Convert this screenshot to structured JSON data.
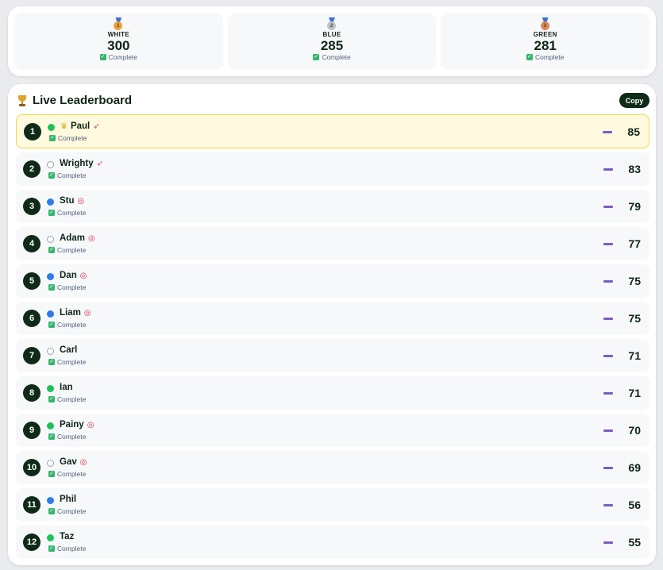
{
  "teams": [
    {
      "name": "WHITE",
      "score": "300",
      "status": "Complete",
      "medal_number": "1",
      "medal_color": "#e6a23c"
    },
    {
      "name": "BLUE",
      "score": "285",
      "status": "Complete",
      "medal_number": "2",
      "medal_color": "#b9c2cc"
    },
    {
      "name": "GREEN",
      "score": "281",
      "status": "Complete",
      "medal_number": "3",
      "medal_color": "#d98a5a"
    }
  ],
  "leaderboard": {
    "title": "Live Leaderboard",
    "copy_label": "Copy",
    "rows": [
      {
        "rank": "1",
        "name": "Paul",
        "status": "Complete",
        "score": "85",
        "team_dot": "green",
        "crown": true,
        "badge": "rocket"
      },
      {
        "rank": "2",
        "name": "Wrighty",
        "status": "Complete",
        "score": "83",
        "team_dot": "none",
        "crown": false,
        "badge": "rocket"
      },
      {
        "rank": "3",
        "name": "Stu",
        "status": "Complete",
        "score": "79",
        "team_dot": "blue",
        "crown": false,
        "badge": "target"
      },
      {
        "rank": "4",
        "name": "Adam",
        "status": "Complete",
        "score": "77",
        "team_dot": "none",
        "crown": false,
        "badge": "target"
      },
      {
        "rank": "5",
        "name": "Dan",
        "status": "Complete",
        "score": "75",
        "team_dot": "blue",
        "crown": false,
        "badge": "target"
      },
      {
        "rank": "6",
        "name": "Liam",
        "status": "Complete",
        "score": "75",
        "team_dot": "blue",
        "crown": false,
        "badge": "target"
      },
      {
        "rank": "7",
        "name": "Carl",
        "status": "Complete",
        "score": "71",
        "team_dot": "none",
        "crown": false,
        "badge": ""
      },
      {
        "rank": "8",
        "name": "Ian",
        "status": "Complete",
        "score": "71",
        "team_dot": "green",
        "crown": false,
        "badge": ""
      },
      {
        "rank": "9",
        "name": "Painy",
        "status": "Complete",
        "score": "70",
        "team_dot": "green",
        "crown": false,
        "badge": "target"
      },
      {
        "rank": "10",
        "name": "Gav",
        "status": "Complete",
        "score": "69",
        "team_dot": "none",
        "crown": false,
        "badge": "target"
      },
      {
        "rank": "11",
        "name": "Phil",
        "status": "Complete",
        "score": "56",
        "team_dot": "blue",
        "crown": false,
        "badge": ""
      },
      {
        "rank": "12",
        "name": "Taz",
        "status": "Complete",
        "score": "55",
        "team_dot": "green",
        "crown": false,
        "badge": ""
      }
    ]
  },
  "colors": {
    "leader_highlight": "#fff9df",
    "leader_border": "#eed84a",
    "dark_green": "#0f2a17",
    "team_green": "#1fc25a",
    "team_blue": "#2f7bea",
    "trend_flat": "#7c5cc4"
  }
}
